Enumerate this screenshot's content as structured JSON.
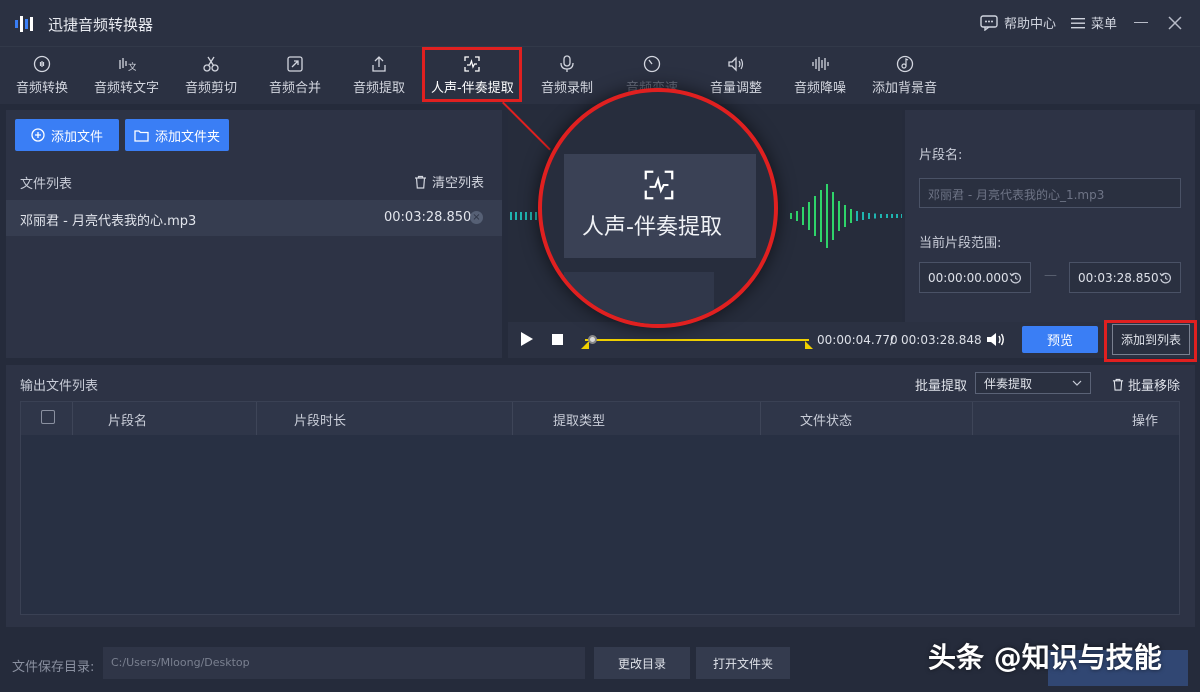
{
  "app": {
    "title": "迅捷音频转换器",
    "help": "帮助中心",
    "menu": "菜单"
  },
  "toolbar": {
    "items": [
      {
        "label": "音频转换",
        "icon": "audio-convert-icon"
      },
      {
        "label": "音频转文字",
        "icon": "speech-to-text-icon"
      },
      {
        "label": "音频剪切",
        "icon": "scissors-icon"
      },
      {
        "label": "音频合并",
        "icon": "merge-icon"
      },
      {
        "label": "音频提取",
        "icon": "upload-icon"
      },
      {
        "label": "人声-伴奏提取",
        "icon": "voice-extract-icon"
      },
      {
        "label": "音频录制",
        "icon": "microphone-icon"
      },
      {
        "label": "音频变速",
        "icon": "speedometer-icon"
      },
      {
        "label": "音量调整",
        "icon": "speaker-icon"
      },
      {
        "label": "音频降噪",
        "icon": "noise-reduce-icon"
      },
      {
        "label": "添加背景音",
        "icon": "music-disc-icon"
      }
    ]
  },
  "files": {
    "add_file": "添加文件",
    "add_folder": "添加文件夹",
    "list_title": "文件列表",
    "clear": "清空列表",
    "items": [
      {
        "name": "邓丽君 - 月亮代表我的心.mp3",
        "duration": "00:03:28.850"
      }
    ]
  },
  "segment": {
    "name_label": "片段名:",
    "name_placeholder": "邓丽君 - 月亮代表我的心_1.mp3",
    "range_label": "当前片段范围:",
    "start": "00:00:00.000",
    "end": "00:03:28.850"
  },
  "player": {
    "current": "00:00:04.770",
    "separator": "/",
    "total": "00:03:28.848",
    "preview": "预览",
    "add_to_list": "添加到列表",
    "progress": 0.023
  },
  "output": {
    "title": "输出文件列表",
    "batch_label": "批量提取",
    "batch_value": "伴奏提取",
    "batch_remove": "批量移除",
    "columns": [
      "片段名",
      "片段时长",
      "提取类型",
      "文件状态",
      "操作"
    ]
  },
  "footer": {
    "save_label": "文件保存目录:",
    "save_path": "C:/Users/Mloong/Desktop",
    "change_dir": "更改目录",
    "open_folder": "打开文件夹"
  },
  "callout": {
    "label": "人声-伴奏提取"
  },
  "watermark": "头条 @知识与技能",
  "colors": {
    "accent": "#3a7ef5",
    "highlight": "#e02020",
    "wave_teal": "#1fb5b0",
    "wave_green": "#2fd46a",
    "track": "#f0d000"
  }
}
